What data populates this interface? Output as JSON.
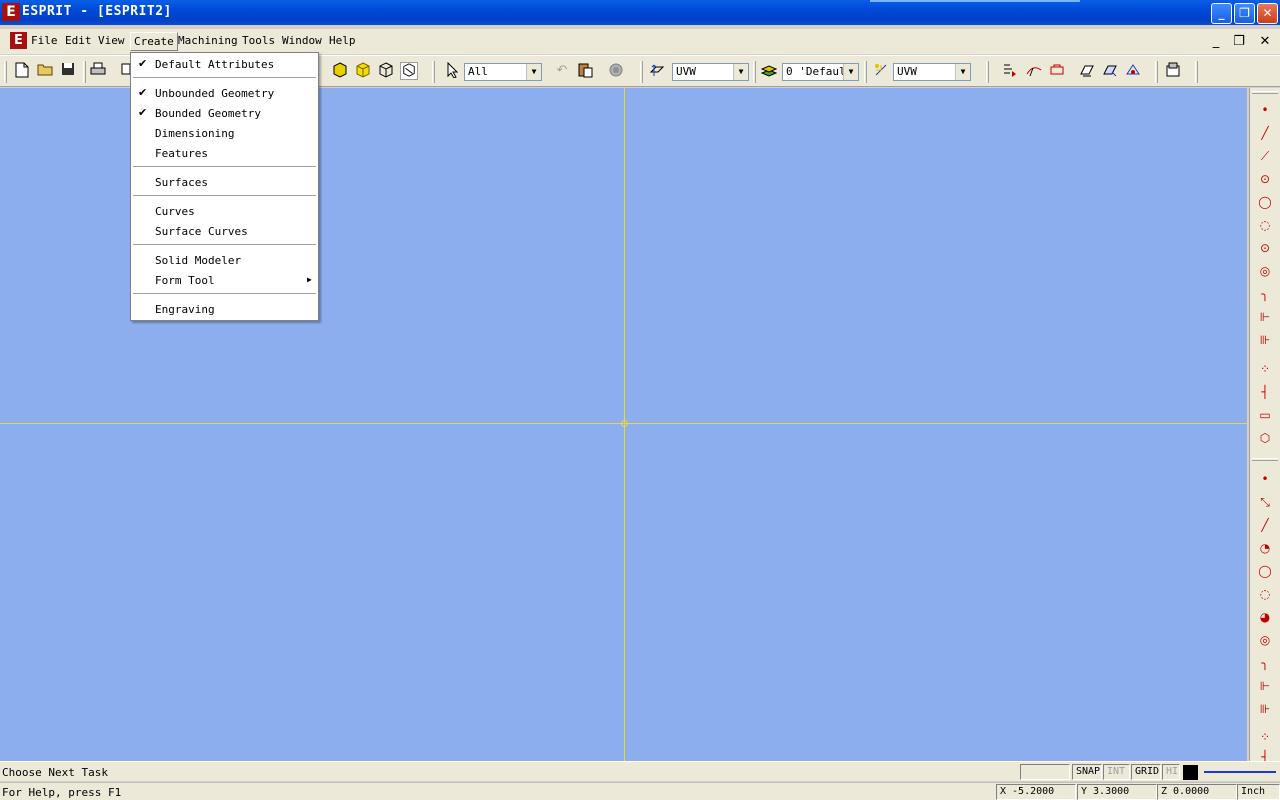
{
  "window": {
    "app_icon_letter": "E",
    "title": "ESPRIT - [ESPRIT2]",
    "controls": {
      "minimize": "_",
      "restore": "❐",
      "close": "✕"
    }
  },
  "menubar": {
    "doc_icon_letter": "E",
    "items": [
      {
        "label": "File"
      },
      {
        "label": "Edit"
      },
      {
        "label": "View"
      },
      {
        "label": "Create"
      },
      {
        "label": "Machining"
      },
      {
        "label": "Tools"
      },
      {
        "label": "Window"
      },
      {
        "label": "Help"
      }
    ],
    "active": "Create",
    "mdi_controls": {
      "minimize": "_",
      "restore": "❐",
      "close": "✕"
    }
  },
  "toolbar": {
    "selection_filter": "All",
    "view_plane_1": "UVW",
    "layer": "0 'Defaul",
    "view_plane_2": "UVW"
  },
  "create_menu": {
    "items": [
      {
        "label": "Default Attributes",
        "checked": true
      },
      {
        "label": "Unbounded Geometry",
        "checked": true
      },
      {
        "label": "Bounded Geometry",
        "checked": true
      },
      {
        "label": "Dimensioning",
        "checked": false
      },
      {
        "label": "Features",
        "checked": false
      },
      {
        "label": "Surfaces",
        "checked": false
      },
      {
        "label": "Curves",
        "checked": false
      },
      {
        "label": "Surface Curves",
        "checked": false
      },
      {
        "label": "Solid Modeler",
        "checked": false
      },
      {
        "label": "Form Tool",
        "checked": false,
        "submenu": true
      },
      {
        "label": "Engraving",
        "checked": false
      }
    ]
  },
  "status": {
    "task_prompt": "Choose Next Task",
    "help_hint": "For Help, press F1",
    "snap": "SNAP",
    "int": "INT",
    "grid": "GRID",
    "hi": "HI",
    "current_color": "#000000",
    "x": "X -5.2000",
    "y": "Y 3.3000",
    "z": "Z 0.0000",
    "units": "Inch"
  },
  "colors": {
    "canvas": "#8daeee",
    "axis": "#e8d840",
    "geometry_icon": "#c00000"
  }
}
